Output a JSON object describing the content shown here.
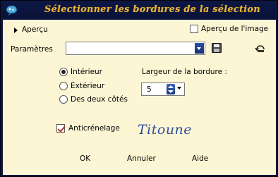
{
  "window": {
    "title": "Sélectionner les bordures de la sélection"
  },
  "preview": {
    "label": "Aperçu",
    "image_preview_label": "Aperçu de l'image",
    "image_preview_checked": false
  },
  "params": {
    "label": "Paramètres",
    "value": ""
  },
  "options": {
    "interior": "Intérieur",
    "exterior": "Extérieur",
    "both": "Des deux côtés",
    "selected": "interior"
  },
  "border_width": {
    "label": "Largeur de la bordure :",
    "value": "5"
  },
  "antialias": {
    "label": "Anticrénelage",
    "checked": true
  },
  "signature": "Titoune",
  "buttons": {
    "ok": "OK",
    "cancel": "Annuler",
    "help": "Aide"
  },
  "colors": {
    "title": "#e6b43a",
    "frame": "#0d1640",
    "panel": "#fcf6d4"
  }
}
